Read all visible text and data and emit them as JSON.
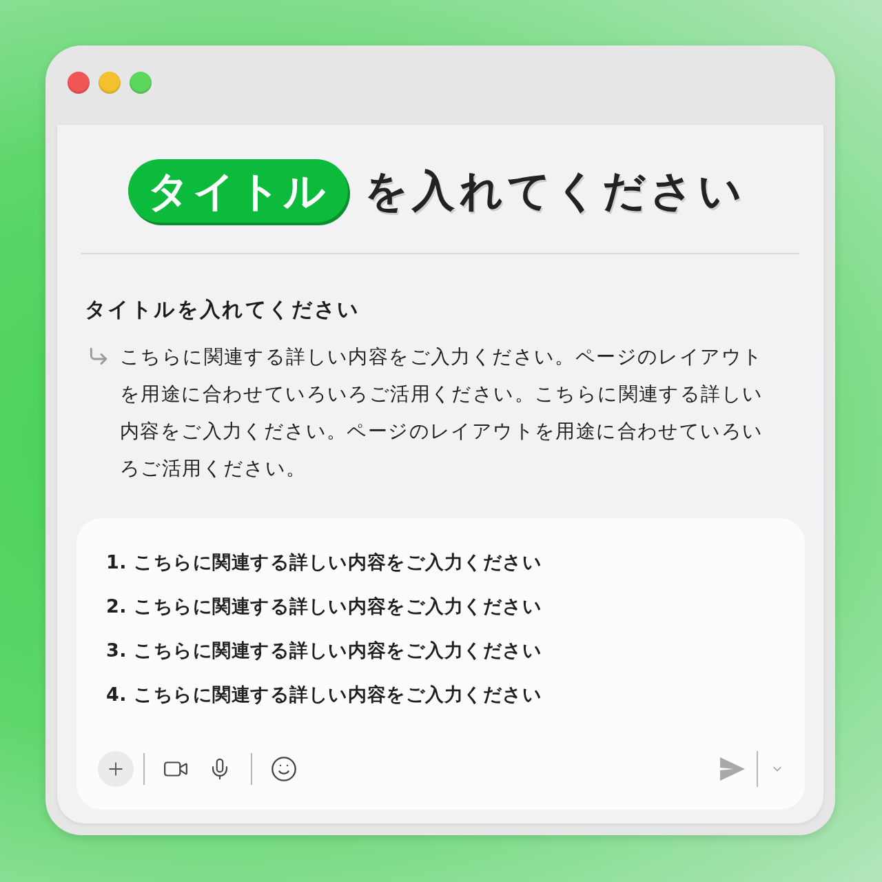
{
  "window": {
    "controls": [
      {
        "color": "#f05656"
      },
      {
        "color": "#f2c12e"
      },
      {
        "color": "#5cd65c"
      }
    ]
  },
  "header": {
    "highlight": "タイトル",
    "text": "を入れてください"
  },
  "section": {
    "title": "タイトルを入れてください",
    "body": "こちらに関連する詳しい内容をご入力ください。ページのレイアウトを用途に合わせていろいろご活用ください。こちらに関連する詳しい内容をご入力ください。ページのレイアウトを用途に合わせていろいろご活用ください。"
  },
  "composer": {
    "lines": [
      "1. こちらに関連する詳しい内容をご入力ください",
      "2. こちらに関連する詳しい内容をご入力ください",
      "3. こちらに関連する詳しい内容をご入力ください",
      "4. こちらに関連する詳しい内容をご入力ください"
    ]
  }
}
